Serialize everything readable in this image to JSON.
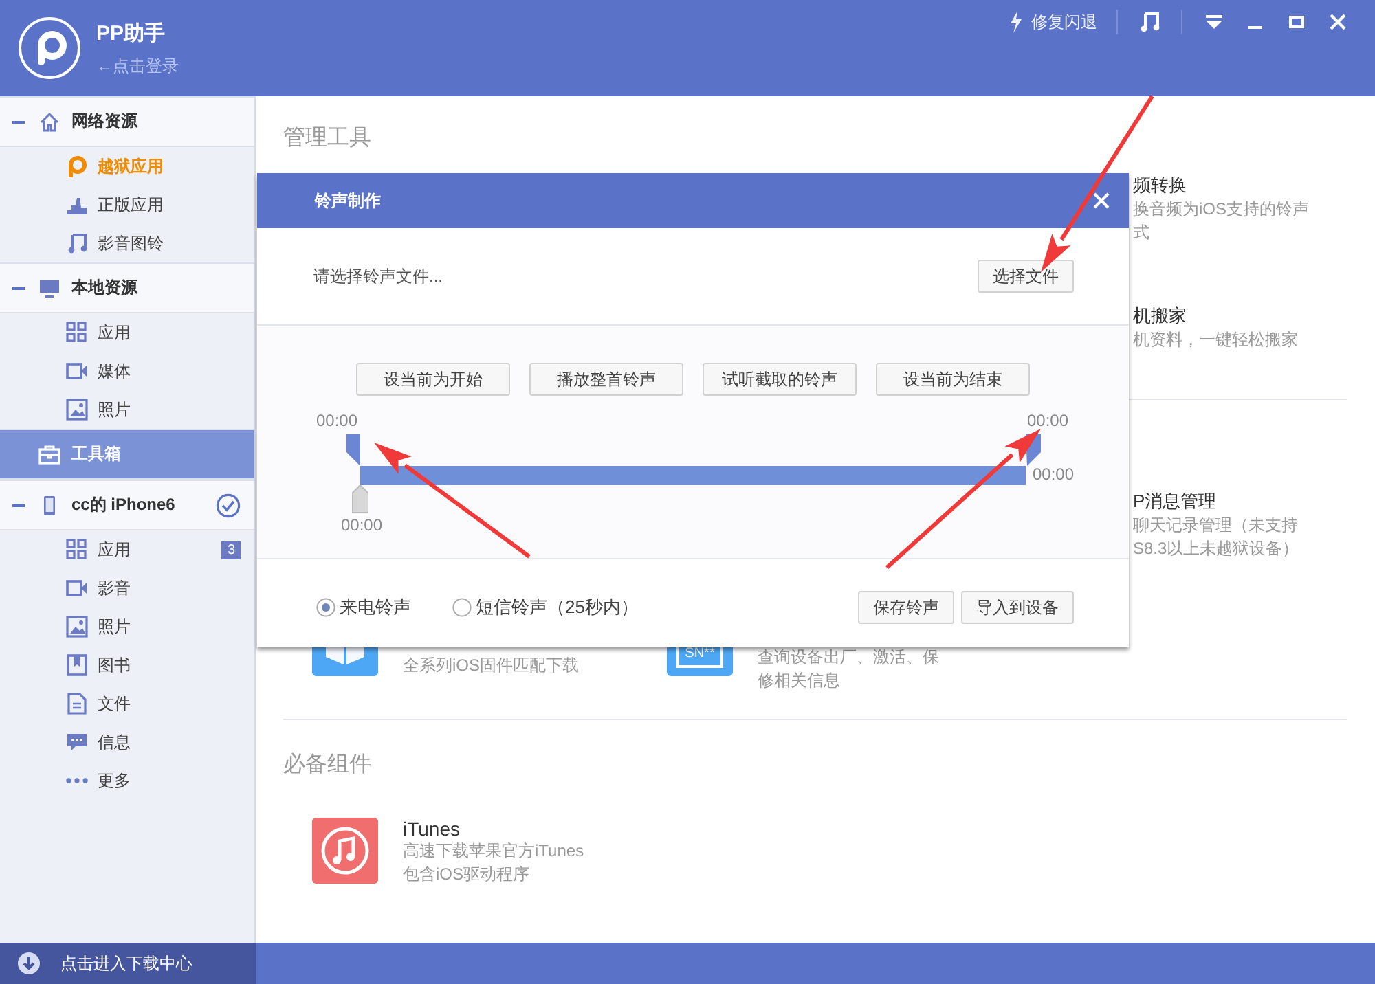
{
  "app": {
    "name": "PP助手",
    "login": "←点击登录"
  },
  "toolbar": {
    "repair": "修复闪退"
  },
  "sidebar": {
    "groups": [
      {
        "label": "网络资源",
        "expanded": true,
        "selected": false,
        "children": [
          {
            "label": "越狱应用",
            "selected": true
          },
          {
            "label": "正版应用",
            "selected": false
          },
          {
            "label": "影音图铃",
            "selected": false
          }
        ]
      },
      {
        "label": "本地资源",
        "expanded": true,
        "selected": false,
        "children": [
          {
            "label": "应用",
            "selected": false
          },
          {
            "label": "媒体",
            "selected": false
          },
          {
            "label": "照片",
            "selected": false
          }
        ]
      },
      {
        "label": "工具箱",
        "selected": true
      },
      {
        "label": "cc的 iPhone6",
        "expanded": true,
        "selected": false,
        "connected": true,
        "children": [
          {
            "label": "应用",
            "selected": false,
            "badge": "3"
          },
          {
            "label": "影音",
            "selected": false
          },
          {
            "label": "照片",
            "selected": false
          },
          {
            "label": "图书",
            "selected": false
          },
          {
            "label": "文件",
            "selected": false
          },
          {
            "label": "信息",
            "selected": false
          },
          {
            "label": "更多",
            "selected": false
          }
        ]
      }
    ],
    "footer": "点击进入下载中心"
  },
  "main": {
    "title": "管理工具",
    "tools": [
      {
        "title": "频转换",
        "lines": [
          "换音频为iOS支持的铃声",
          "式"
        ]
      },
      {
        "title": "机搬家",
        "lines": [
          "机资料，一键轻松搬家"
        ]
      },
      {
        "title": "P消息管理",
        "lines": [
          "聊天记录管理（未支持",
          "S8.3以上未越狱设备）"
        ]
      },
      {
        "lines": [
          "全系列iOS固件匹配下载"
        ]
      },
      {
        "icon_label": "SN**",
        "lines": [
          "查询设备出厂、激活、保",
          "修相关信息"
        ]
      }
    ],
    "components": {
      "title": "必备组件",
      "items": [
        {
          "title": "iTunes",
          "lines": [
            "高速下载苹果官方iTunes",
            "包含iOS驱动程序"
          ]
        }
      ]
    }
  },
  "dialog": {
    "title": "铃声制作",
    "prompt": "请选择铃声文件...",
    "choose_button": "选择文件",
    "controls": [
      "设当前为开始",
      "播放整首铃声",
      "试听截取的铃声",
      "设当前为结束"
    ],
    "timeline": {
      "start_time": "00:00",
      "end_time": "00:00",
      "total_time": "00:00",
      "playhead": {
        "level": 0,
        "time": "00:00"
      }
    },
    "ringtone_types": [
      {
        "label": "来电铃声",
        "selected": true
      },
      {
        "label": "短信铃声（25秒内）",
        "selected": false
      }
    ],
    "actions": [
      "保存铃声",
      "导入到设备"
    ]
  }
}
